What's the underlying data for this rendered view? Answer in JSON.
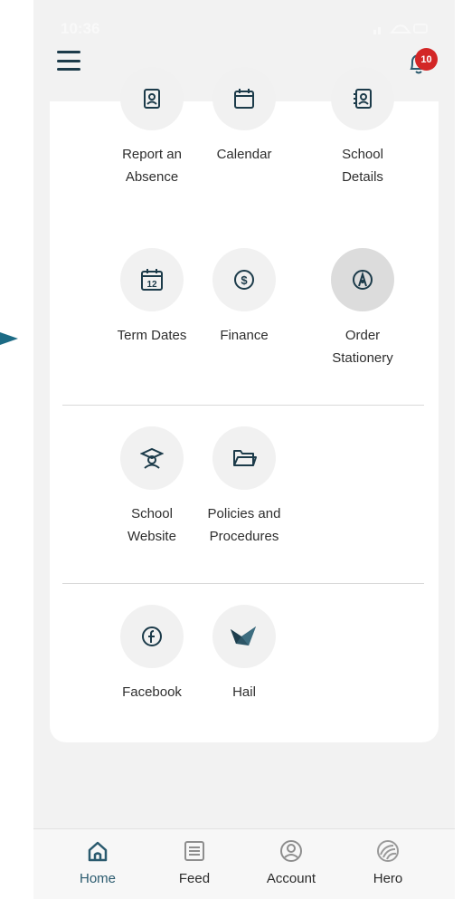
{
  "status": {
    "time": "10:36"
  },
  "header": {
    "badge_count": "10"
  },
  "colors": {
    "icon": "#1c3b4a",
    "badge": "#d32626",
    "accent": "#2a5a6e"
  },
  "sections": [
    {
      "tiles": [
        {
          "label": "Report an\nAbsence",
          "icon": "contact-book-icon"
        },
        {
          "label": "Calendar",
          "icon": "calendar-icon"
        },
        {
          "label": "School\nDetails",
          "icon": "address-book-icon"
        },
        {
          "label": "Term Dates",
          "icon": "calendar-12-icon",
          "day": "12"
        },
        {
          "label": "Finance",
          "icon": "dollar-icon"
        },
        {
          "label": "Order\nStationery",
          "icon": "compass-icon"
        }
      ]
    },
    {
      "tiles": [
        {
          "label": "School\nWebsite",
          "icon": "graduate-icon"
        },
        {
          "label": "Policies and\nProcedures",
          "icon": "folder-icon"
        }
      ]
    },
    {
      "tiles": [
        {
          "label": "Facebook",
          "icon": "facebook-icon"
        },
        {
          "label": "Hail",
          "icon": "hail-logo-icon"
        }
      ]
    }
  ],
  "nav": [
    {
      "label": "Home",
      "icon": "home-icon",
      "active": true
    },
    {
      "label": "Feed",
      "icon": "feed-icon"
    },
    {
      "label": "Account",
      "icon": "account-icon"
    },
    {
      "label": "Hero",
      "icon": "hero-icon"
    }
  ]
}
